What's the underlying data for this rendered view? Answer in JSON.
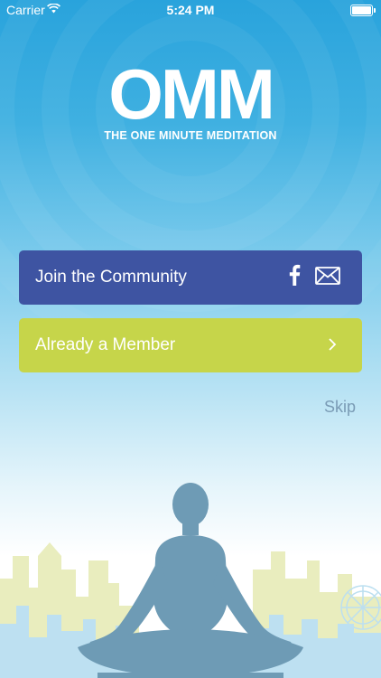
{
  "status_bar": {
    "carrier": "Carrier",
    "time": "5:24 PM",
    "battery_level": 1.0
  },
  "logo": {
    "mark": "OMM",
    "tagline": "THE ONE MINUTE MEDITATION"
  },
  "join_button": {
    "label": "Join the Community",
    "icons": [
      "facebook-icon",
      "mail-icon"
    ]
  },
  "member_button": {
    "label": "Already a Member",
    "icon": "chevron-right-icon"
  },
  "skip": {
    "label": "Skip"
  },
  "colors": {
    "sky_top": "#29a3dc",
    "join_bg": "#3e54a2",
    "member_bg": "#c6d54a",
    "skip_text": "#7a9bb5",
    "figure": "#6e9bb5"
  }
}
